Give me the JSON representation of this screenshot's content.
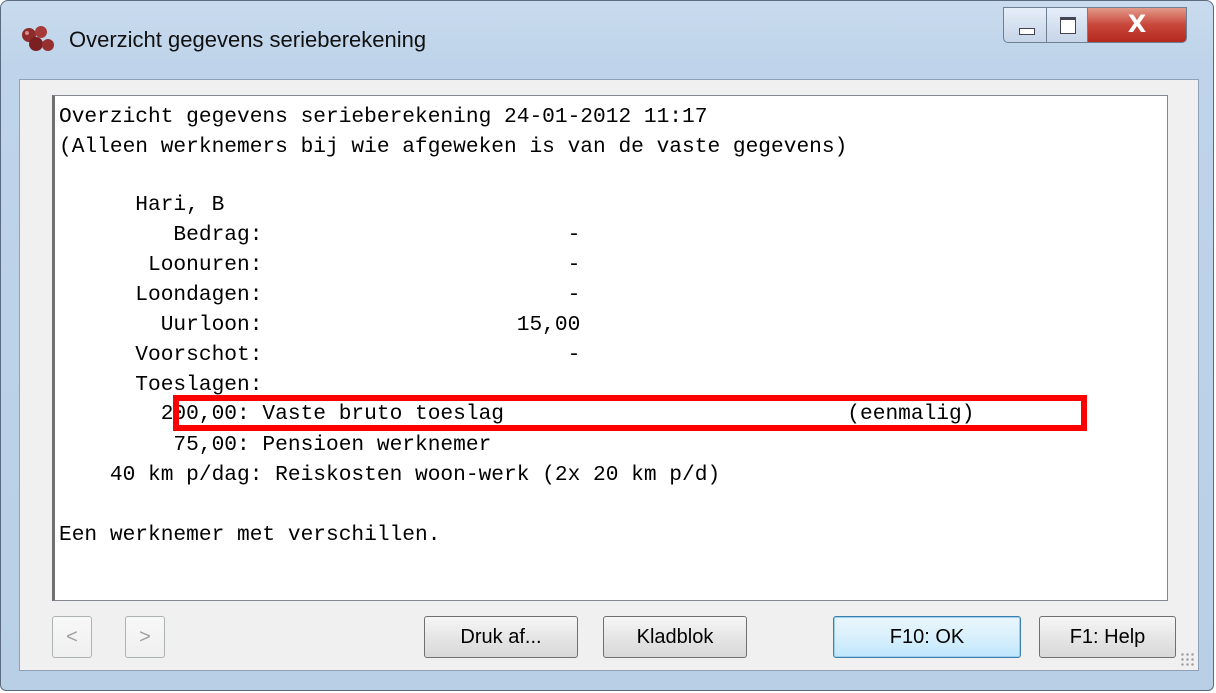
{
  "window": {
    "title": "Overzicht gegevens serieberekening"
  },
  "report": {
    "lines": [
      "Overzicht gegevens serieberekening 24-01-2012 11:17",
      "(Alleen werknemers bij wie afgeweken is van de vaste gegevens)",
      "      Hari, B",
      "         Bedrag:                        -",
      "       Loonuren:                        -",
      "      Loondagen:                        -",
      "        Uurloon:                    15,00",
      "      Voorschot:                        -",
      "      Toeslagen:",
      "        200,00: Vaste bruto toeslag                           (eenmalig)",
      "         75,00: Pensioen werknemer",
      "    40 km p/dag: Reiskosten woon-werk (2x 20 km p/d)",
      "Een werknemer met verschillen."
    ]
  },
  "buttons": {
    "prev": "<",
    "next": ">",
    "print": "Druk af...",
    "notepad": "Kladblok",
    "ok": "F10: OK",
    "help": "F1: Help"
  },
  "colors": {
    "highlight": "#ff0000",
    "title_bar": "#c9dbee"
  }
}
